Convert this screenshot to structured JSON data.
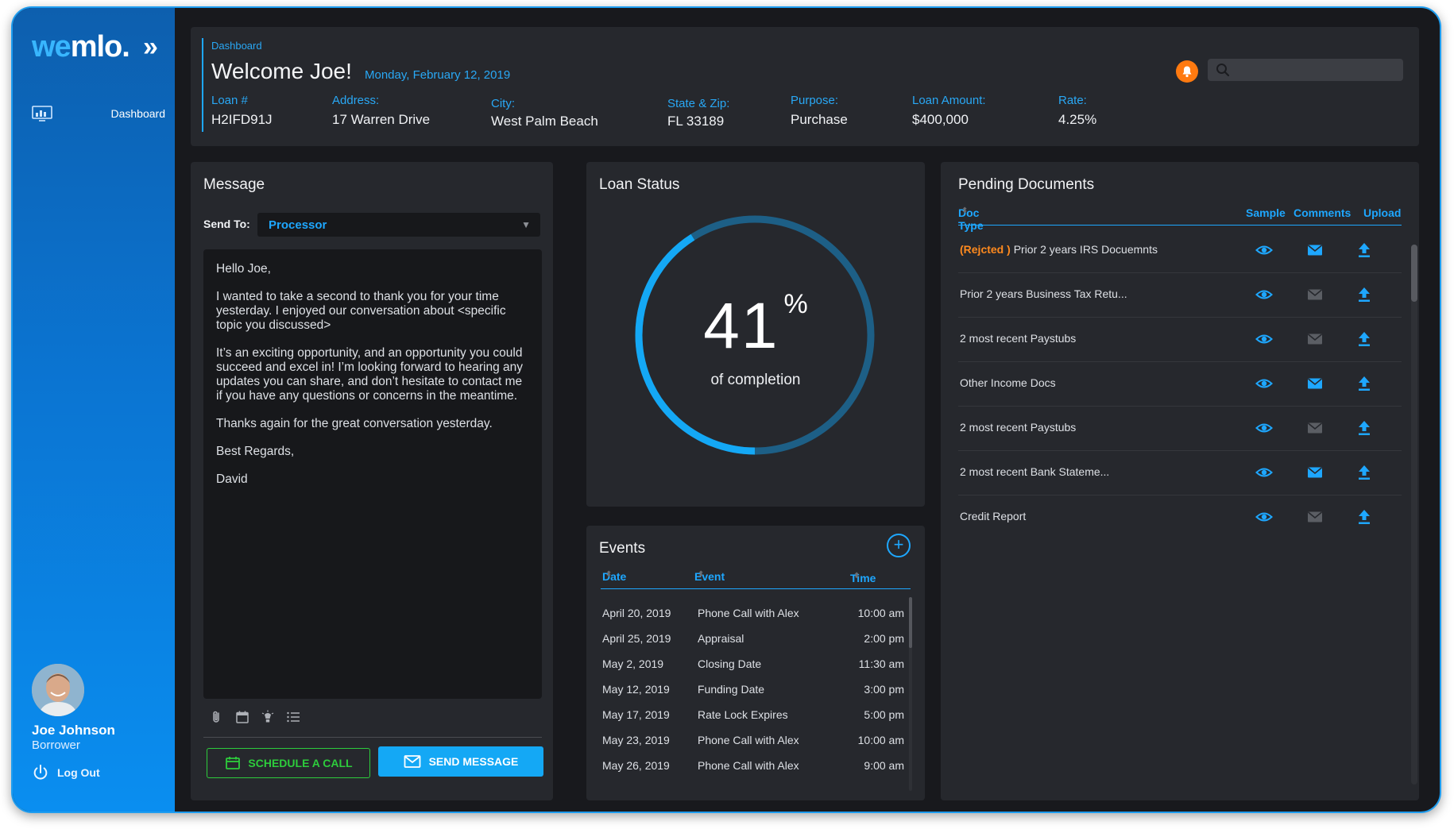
{
  "app": {
    "logo_we": "we",
    "logo_rest": "mlo.",
    "logo_chevron": "»"
  },
  "sidebar": {
    "items": [
      {
        "label": "Dashboard",
        "icon": "dashboard-monitor-icon"
      }
    ],
    "user": {
      "name": "Joe Johnson",
      "role": "Borrower"
    },
    "logout_label": "Log Out"
  },
  "header": {
    "breadcrumb": "Dashboard",
    "welcome": "Welcome Joe!",
    "date": "Monday, February 12,  2019",
    "search_placeholder": "",
    "fields": [
      {
        "label": "Loan #",
        "value": "H2IFD91J"
      },
      {
        "label": "Address:",
        "value": "17 Warren Drive"
      },
      {
        "label": "City:",
        "value": "West Palm Beach"
      },
      {
        "label": "State & Zip:",
        "value": "FL 33189"
      },
      {
        "label": "Purpose:",
        "value": "Purchase"
      },
      {
        "label": "Loan Amount:",
        "value": "$400,000"
      },
      {
        "label": "Rate:",
        "value": "4.25%"
      }
    ]
  },
  "message": {
    "title": "Message",
    "send_to_label": "Send To:",
    "send_to_value": "Processor",
    "body": [
      "Hello Joe,",
      "I wanted to take a second to thank you for your time yesterday. I enjoyed our conversation about <specific topic you discussed>",
      "It’s an exciting opportunity, and an opportunity you could succeed and excel in! I’m looking forward to hearing any updates you can share, and don’t hesitate to contact me if you have any questions or concerns in the meantime.",
      "Thanks again for the great conversation yesterday.",
      "Best Regards,",
      "David"
    ],
    "toolbar_icons": [
      "paperclip-icon",
      "calendar-icon",
      "lightbulb-icon",
      "list-icon"
    ],
    "schedule_label": "SCHEDULE A CALL",
    "send_label": "SEND MESSAGE"
  },
  "loan_status": {
    "title": "Loan Status",
    "percent": 41,
    "percent_text": "41",
    "percent_symbol": "%",
    "label": "of completion",
    "colors": {
      "progress": "#14a8f5",
      "track": "#1d5f86"
    }
  },
  "events": {
    "title": "Events",
    "add_symbol": "+",
    "columns": [
      "Date",
      "Event",
      "Time"
    ],
    "rows": [
      {
        "date": "April 20, 2019",
        "event": "Phone Call with Alex",
        "time": "10:00 am"
      },
      {
        "date": "April 25, 2019",
        "event": "Appraisal",
        "time": "2:00 pm"
      },
      {
        "date": "May 2, 2019",
        "event": "Closing Date",
        "time": "11:30 am"
      },
      {
        "date": "May 12, 2019",
        "event": "Funding Date",
        "time": "3:00 pm"
      },
      {
        "date": "May 17, 2019",
        "event": "Rate Lock Expires",
        "time": "5:00 pm"
      },
      {
        "date": "May 23, 2019",
        "event": "Phone Call with Alex",
        "time": "10:00 am"
      },
      {
        "date": "May 26, 2019",
        "event": "Phone Call with Alex",
        "time": "9:00 am"
      }
    ]
  },
  "documents": {
    "title": "Pending Documents",
    "columns": [
      "Doc Type",
      "Sample",
      "Comments",
      "Upload"
    ],
    "rejected_label": "(Rejcted )",
    "rows": [
      {
        "rejected": true,
        "name": "Prior 2 years IRS Docuemnts",
        "has_comment": true
      },
      {
        "rejected": false,
        "name": "Prior 2 years Business Tax Retu...",
        "has_comment": false
      },
      {
        "rejected": false,
        "name": "2 most recent Paystubs",
        "has_comment": false
      },
      {
        "rejected": false,
        "name": "Other Income Docs",
        "has_comment": true
      },
      {
        "rejected": false,
        "name": "2 most recent Paystubs",
        "has_comment": false
      },
      {
        "rejected": false,
        "name": "2 most recent Bank Stateme...",
        "has_comment": true
      },
      {
        "rejected": false,
        "name": "Credit Report",
        "has_comment": false
      }
    ],
    "colors": {
      "accent": "#1ea7ff",
      "inactive": "#5b5e64",
      "rejected": "#ff8a1e"
    }
  }
}
